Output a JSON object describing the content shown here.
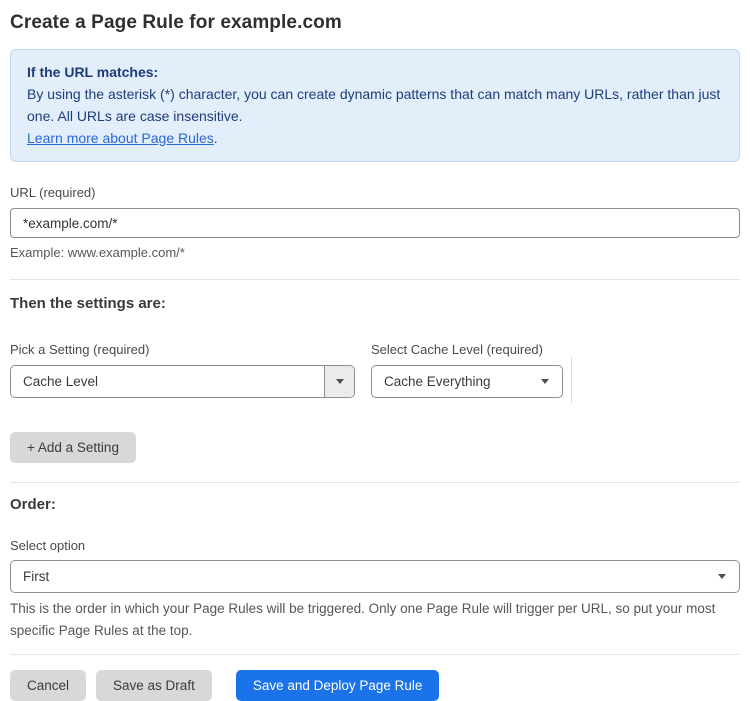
{
  "page": {
    "title": "Create a Page Rule for example.com"
  },
  "info_box": {
    "heading": "If the URL matches:",
    "body": "By using the asterisk (*) character, you can create dynamic patterns that can match many URLs, rather than just one. All URLs are case insensitive.",
    "link_label": "Learn more about Page Rules",
    "link_suffix": "."
  },
  "url_field": {
    "label": "URL (required)",
    "value": "*example.com/*",
    "helper": "Example: www.example.com/*"
  },
  "settings_section": {
    "heading": "Then the settings are:",
    "setting_select": {
      "label": "Pick a Setting (required)",
      "value": "Cache Level"
    },
    "cache_level_select": {
      "label": "Select Cache Level (required)",
      "value": "Cache Everything"
    },
    "add_setting_label": "+ Add a Setting"
  },
  "order_section": {
    "heading": "Order:",
    "select_label": "Select option",
    "value": "First",
    "helper": "This is the order in which your Page Rules will be triggered. Only one Page Rule will trigger per URL, so put your most specific Page Rules at the top."
  },
  "actions": {
    "cancel": "Cancel",
    "save_draft": "Save as Draft",
    "save_deploy": "Save and Deploy Page Rule"
  },
  "colors": {
    "info_bg": "#e3eefb",
    "info_border": "#bed8f3",
    "info_text": "#1e3d78",
    "link": "#2968d6",
    "primary_button": "#1a73e8"
  }
}
